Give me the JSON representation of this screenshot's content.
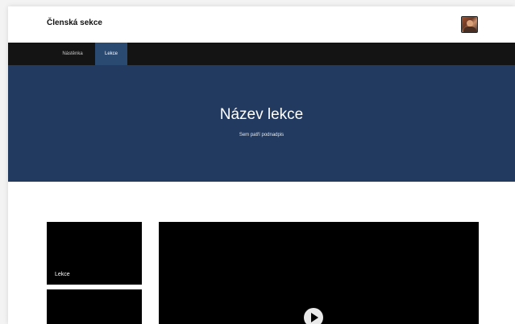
{
  "header": {
    "site_title": "Členská sekce",
    "avatar_icon": "user-avatar"
  },
  "nav": {
    "items": [
      {
        "label": "Nástěnka",
        "active": false
      },
      {
        "label": "Lekce",
        "active": true
      }
    ]
  },
  "hero": {
    "title": "Název lekce",
    "subtitle": "Sem patří podnadpis"
  },
  "sidebar": {
    "cards": [
      {
        "label": "Lekce"
      },
      {
        "label": ""
      }
    ]
  },
  "video": {
    "play_icon": "play-icon"
  },
  "colors": {
    "nav_background": "#141414",
    "nav_active": "#2a4a72",
    "hero_background": "#223a5f",
    "card_background": "#000000"
  }
}
